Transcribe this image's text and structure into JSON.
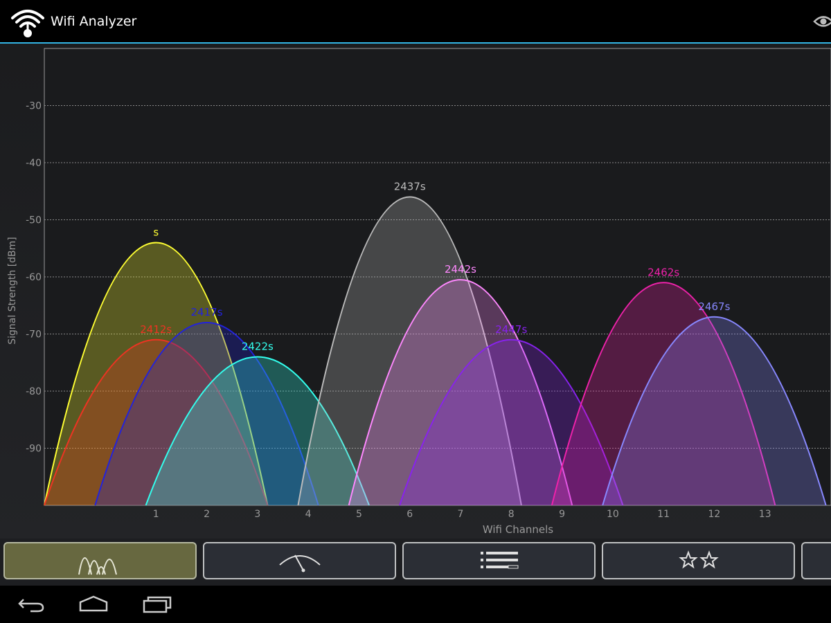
{
  "app": {
    "title": "Wifi Analyzer",
    "icon": "wifi-antenna-icon",
    "action_icon": "eye-icon"
  },
  "colors": {
    "action_bar_bg": "#000000",
    "action_bar_underline": "#33b5e5",
    "chart_bg": "#1b1c1e",
    "grid": "#8a8a8a",
    "axis_text": "#9a9a9a",
    "active_tab": "#676840"
  },
  "tabs": [
    {
      "name": "channel-graph",
      "icon": "channel-graph-icon",
      "active": true
    },
    {
      "name": "signal-meter",
      "icon": "signal-meter-icon",
      "active": false
    },
    {
      "name": "ap-list",
      "icon": "ap-list-icon",
      "active": false
    },
    {
      "name": "channel-rating",
      "icon": "star-rating-icon",
      "active": false
    }
  ],
  "nav": {
    "back_icon": "back-arrow-icon",
    "home_icon": "home-icon",
    "recents_icon": "recent-apps-icon"
  },
  "chart_data": {
    "type": "area",
    "xlabel": "Wifi Channels",
    "ylabel": "Signal Strength [dBm]",
    "xlim": [
      -1.2,
      14.3
    ],
    "ylim": [
      -100,
      -20
    ],
    "xticks": [
      1,
      2,
      3,
      4,
      5,
      6,
      7,
      8,
      9,
      10,
      11,
      12,
      13
    ],
    "yticks": [
      -30,
      -40,
      -50,
      -60,
      -70,
      -80,
      -90
    ],
    "grid": true,
    "series": [
      {
        "name": "s",
        "channel": 1,
        "dbm": -54,
        "color": "#ffff33"
      },
      {
        "name": "2412s",
        "channel": 1,
        "dbm": -71,
        "color": "#ee3322"
      },
      {
        "name": "2417s",
        "channel": 2,
        "dbm": -68,
        "color": "#2222dd"
      },
      {
        "name": "2422s",
        "channel": 3,
        "dbm": -74,
        "color": "#33ffee"
      },
      {
        "name": "2437s",
        "channel": 6,
        "dbm": -46,
        "color": "#bbbbbb"
      },
      {
        "name": "2442s",
        "channel": 7,
        "dbm": -60.5,
        "color": "#ff88ff"
      },
      {
        "name": "2447s",
        "channel": 8,
        "dbm": -71,
        "color": "#8822ee"
      },
      {
        "name": "2462s",
        "channel": 11,
        "dbm": -61,
        "color": "#ee22aa"
      },
      {
        "name": "2467s",
        "channel": 12,
        "dbm": -67,
        "color": "#8888ff"
      }
    ]
  }
}
